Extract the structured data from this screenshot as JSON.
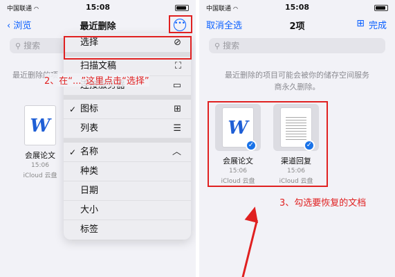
{
  "left_screen": {
    "status": {
      "carrier": "中国联通",
      "time": "15:08"
    },
    "nav": {
      "back": "浏览",
      "title": "最近删除",
      "more_icon": "more-icon"
    },
    "search_placeholder": "搜索",
    "info_partial": "最近删除的项",
    "file": {
      "name": "会展论文",
      "date": "15:06",
      "location": "iCloud 云盘"
    },
    "menu": {
      "items": [
        {
          "label": "选择",
          "icon": "checkmark-circle-icon"
        },
        {
          "label": "扫描文稿",
          "icon": "scan-icon"
        },
        {
          "label": "连接服务器",
          "icon": "server-icon"
        },
        {
          "label": "图标",
          "icon": "grid-icon",
          "checked": true
        },
        {
          "label": "列表",
          "icon": "list-icon"
        },
        {
          "label": "名称",
          "icon": "chevron-up-icon",
          "checked": true
        },
        {
          "label": "种类"
        },
        {
          "label": "日期"
        },
        {
          "label": "大小"
        },
        {
          "label": "标签"
        }
      ]
    },
    "annotation": "2、在“...”这里点击“选择”"
  },
  "right_screen": {
    "status": {
      "carrier": "中国联通",
      "time": "15:08"
    },
    "nav": {
      "left": "取消全选",
      "title": "2项",
      "right": "完成"
    },
    "search_placeholder": "搜索",
    "info_line1": "最近删除的项目可能会被你的储存空间服务",
    "info_line2": "商永久删除。",
    "files": [
      {
        "name": "会展论文",
        "date": "15:06",
        "location": "iCloud 云盘"
      },
      {
        "name": "渠道回复",
        "date": "15:06",
        "location": "iCloud 云盘"
      }
    ],
    "annotation": "3、勾选要恢复的文档"
  },
  "colors": {
    "accent": "#0a60ff",
    "annotation": "#e02020",
    "check": "#1a73e8"
  }
}
